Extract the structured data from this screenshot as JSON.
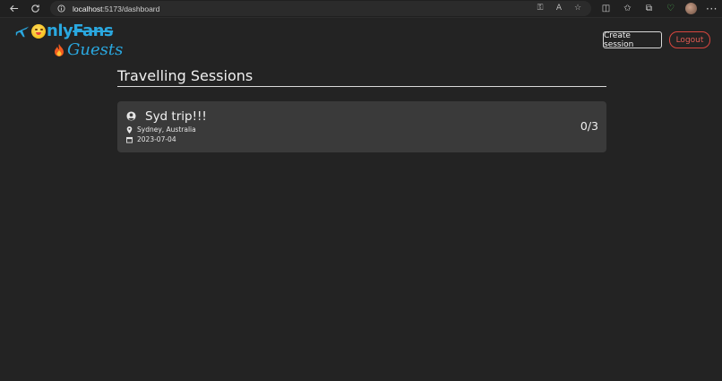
{
  "browser": {
    "url_host": "localhost",
    "url_rest": ":5173/dashboard"
  },
  "logo": {
    "word_only": "nly",
    "word_fans": "Fans",
    "word_guests": "Guests"
  },
  "header": {
    "create_session_label": "Create session",
    "logout_label": "Logout"
  },
  "page": {
    "title": "Travelling Sessions"
  },
  "sessions": [
    {
      "name": "Syd trip!!!",
      "location": "Sydney, Australia",
      "date": "2023-07-04",
      "count": "0/3"
    }
  ],
  "colors": {
    "background": "#232323",
    "card": "#3a3a3a",
    "logo_blue": "#2aa8e0",
    "logout_red": "#e25a52"
  }
}
